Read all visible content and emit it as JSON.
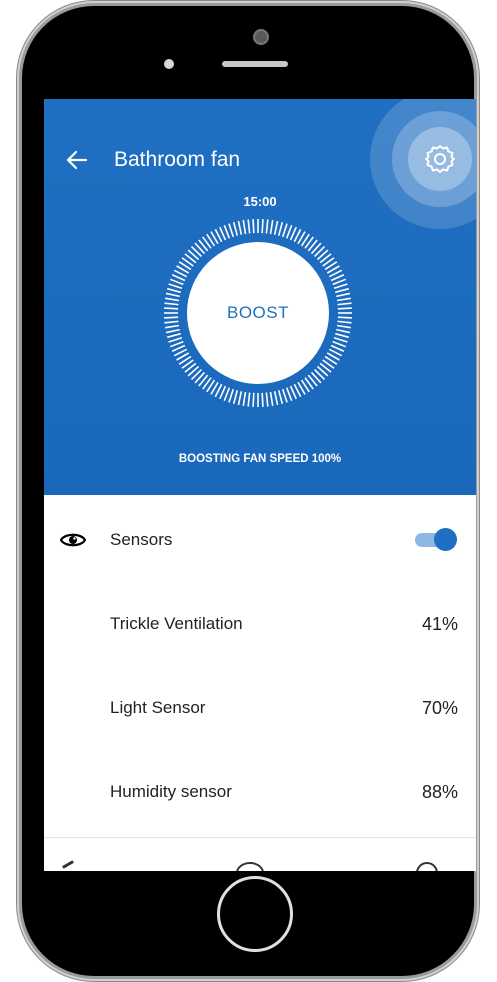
{
  "header": {
    "title": "Bathroom fan",
    "back_icon": "arrow-left-icon",
    "settings_icon": "gear-icon",
    "background_color": "#1f6fc2"
  },
  "boost": {
    "timer": "15:00",
    "button_label": "BOOST",
    "status": "BOOSTING FAN SPEED 100%"
  },
  "sensors": {
    "label": "Sensors",
    "icon": "eye-icon",
    "enabled": true,
    "items": [
      {
        "label": "Trickle Ventilation",
        "value": "41%"
      },
      {
        "label": "Light Sensor",
        "value": "70%"
      },
      {
        "label": "Humidity sensor",
        "value": "88%"
      }
    ]
  }
}
